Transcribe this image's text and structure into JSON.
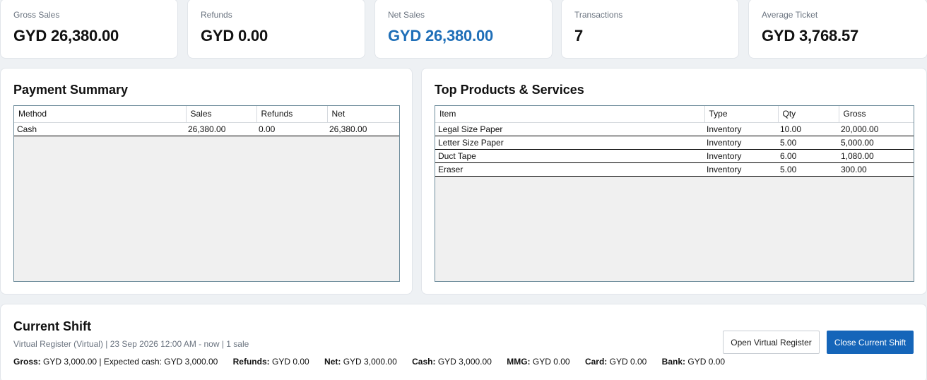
{
  "kpis": [
    {
      "label": "Gross Sales",
      "value": "GYD 26,380.00"
    },
    {
      "label": "Refunds",
      "value": "GYD 0.00"
    },
    {
      "label": "Net Sales",
      "value": "GYD 26,380.00"
    },
    {
      "label": "Transactions",
      "value": "7"
    },
    {
      "label": "Average Ticket",
      "value": "GYD 3,768.57"
    }
  ],
  "payment_summary": {
    "title": "Payment Summary",
    "columns": [
      "Method",
      "Sales",
      "Refunds",
      "Net"
    ],
    "rows": [
      [
        "Cash",
        "26,380.00",
        "0.00",
        "26,380.00"
      ]
    ]
  },
  "top_products": {
    "title": "Top Products & Services",
    "columns": [
      "Item",
      "Type",
      "Qty",
      "Gross"
    ],
    "rows": [
      [
        "Legal Size Paper",
        "Inventory",
        "10.00",
        "20,000.00"
      ],
      [
        "Letter Size Paper",
        "Inventory",
        "5.00",
        "5,000.00"
      ],
      [
        "Duct Tape",
        "Inventory",
        "6.00",
        "1,080.00"
      ],
      [
        "Eraser",
        "Inventory",
        "5.00",
        "300.00"
      ]
    ]
  },
  "current_shift": {
    "title": "Current Shift",
    "meta": "Virtual Register (Virtual) | 23 Sep 2026  12:00 AM - now | 1 sale",
    "gross_label": "Gross:",
    "gross_value": "GYD 3,000.00 | Expected cash: GYD 3,000.00",
    "refunds_label": "Refunds:",
    "refunds_value": "GYD 0.00",
    "net_label": "Net:",
    "net_value": "GYD 3,000.00",
    "cash_label": "Cash:",
    "cash_value": "GYD 3,000.00",
    "mmg_label": "MMG:",
    "mmg_value": "GYD 0.00",
    "card_label": "Card:",
    "card_value": "GYD 0.00",
    "bank_label": "Bank:",
    "bank_value": "GYD 0.00",
    "open_register_label": "Open Virtual Register",
    "close_shift_label": "Close Current Shift"
  },
  "colors": {
    "accent": "#1f6fb8",
    "primary_button": "#1565b9",
    "page_background": "#eef1f4",
    "grid_border": "#6f8d9c"
  }
}
